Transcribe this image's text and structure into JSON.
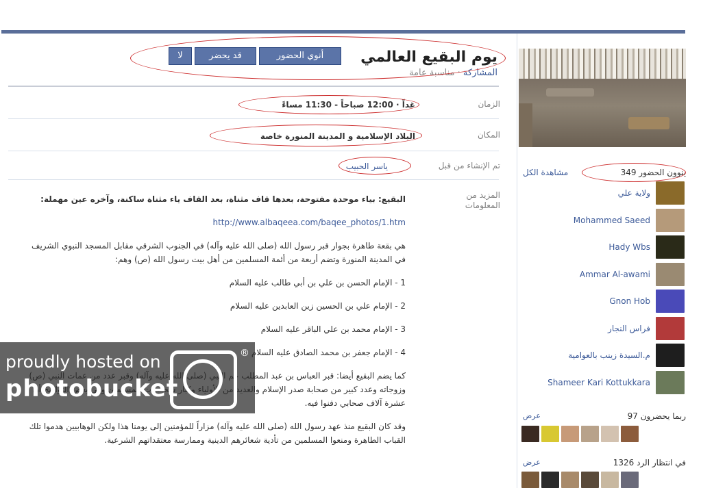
{
  "event": {
    "title": "يوم البقيع العالمي",
    "share_label": "المشاركة",
    "type_label": "مناسبة عامة"
  },
  "rsvp": {
    "going": "أنوي الحضور",
    "maybe": "قد يحضر",
    "no": "لا"
  },
  "details": {
    "time_label": "الزمان",
    "time_value": "غداً · 12:00 صباحاً - 11:30 مساءً",
    "place_label": "المكان",
    "place_value": "البلاد الإسلامية و المدينة المنورة خاصة",
    "created_label": "تم الإنشاء من قبل",
    "created_by": "ياسر الحبيب",
    "more_label": "المزيد من المعلومات"
  },
  "info": {
    "p1": "البقيع: بياء موحدة مفتوحة، بعدها قاف مثناة، بعد القاف ياء مثناة ساكنة، وآخره عين مهملة:",
    "url": "http://www.albaqeea.com/baqee_photos/1.htm",
    "p2": "هي بقعة طاهرة بجوار قبر رسول الله (صلى الله عليه وآله) في الجنوب الشرقي مقابل المسجد النبوي الشريف في المدينة المنورة وتضم أربعة من أئمة المسلمين من أهل بيت رسول الله (ص) وهم:",
    "i1": "1 - الإمام الحسن بن علي بن أبي طالب عليه السلام",
    "i2": "2 - الإمام علي بن الحسين زين العابدين عليه السلام",
    "i3": "3 - الإمام محمد بن علي الباقر عليه السلام",
    "i4": "4 - الإمام جعفر بن محمد الصادق عليه السلام",
    "p3": "كما يضم البقيع أيضا: قبر العباس بن عبد المطلب عم النبي (صلى الله عليه وآله) وقبر عدد من عمات النبي (ص) وزوجاته وعدد كبير من صحابة صدر الإسلام والعديد من الأولياء وكبار شخصيات المسلمين وفي بعض التواريخ أن عشرة آلاف صحابي دفنوا فيه.",
    "p4": "وقد كان البقيع منذ عهد رسول الله (صلى الله عليه وآله) مزاراً للمؤمنين إلى يومنا هذا ولكن الوهابيين هدموا تلك القباب الطاهرة ومنعوا المسلمين من تأدية شعائرهم الدينية وممارسة معتقداتهم الشرعية."
  },
  "attending": {
    "count_text": "349 ينوون الحضور",
    "view_all": "مشاهدة الكل",
    "people": [
      {
        "name": "ولاية علي",
        "color": "#8a6a2a"
      },
      {
        "name": "Mohammed Saeed",
        "color": "#b59a7a"
      },
      {
        "name": "Hady Wbs",
        "color": "#2a2a18"
      },
      {
        "name": "Ammar Al-awami",
        "color": "#9a8a72"
      },
      {
        "name": "Gnon Hob",
        "color": "#4a4ab8"
      },
      {
        "name": "فراس النجار",
        "color": "#b23a3a"
      },
      {
        "name": "م.السيدة زينب بالعوامية",
        "color": "#1e1e1e"
      },
      {
        "name": "Shameer Kari Kottukkara",
        "color": "#6b7a5a"
      }
    ]
  },
  "maybe": {
    "count_text": "97 ربما يحضرون",
    "view": "عرض"
  },
  "awaiting": {
    "count_text": "1326 في انتظار الرد",
    "view": "عرض"
  },
  "watermark": {
    "line1": "proudly hosted on",
    "line2": "photobucket",
    "reg": "®"
  }
}
